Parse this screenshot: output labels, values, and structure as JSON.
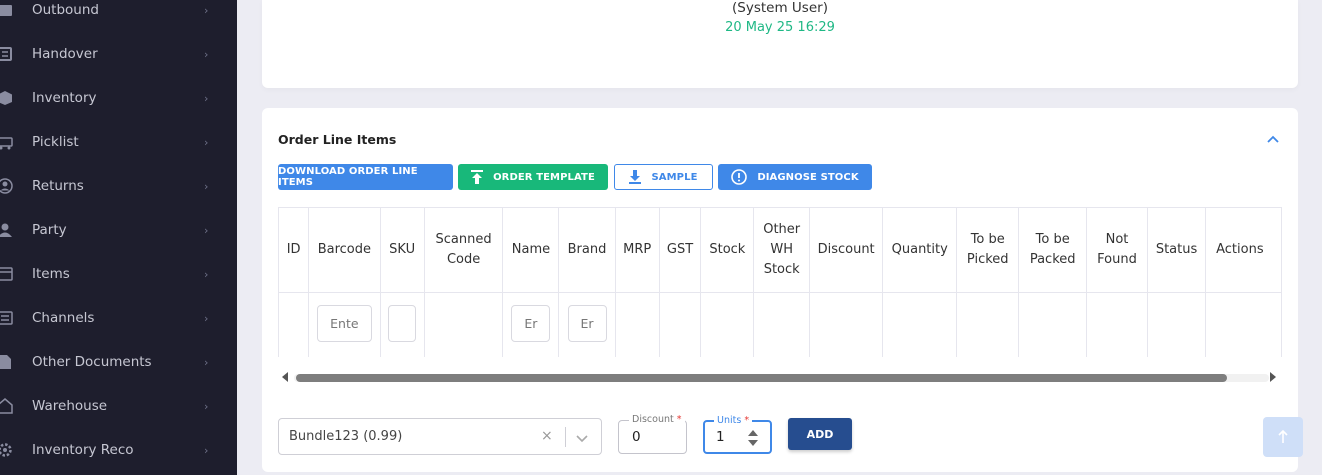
{
  "sidebar": {
    "items": [
      {
        "label": "Outbound",
        "icon": "outbound-icon"
      },
      {
        "label": "Handover",
        "icon": "handover-icon"
      },
      {
        "label": "Inventory",
        "icon": "inventory-box-icon"
      },
      {
        "label": "Picklist",
        "icon": "picklist-icon"
      },
      {
        "label": "Returns",
        "icon": "returns-icon"
      },
      {
        "label": "Party",
        "icon": "party-icon"
      },
      {
        "label": "Items",
        "icon": "items-icon"
      },
      {
        "label": "Channels",
        "icon": "channels-icon"
      },
      {
        "label": "Other Documents",
        "icon": "document-icon"
      },
      {
        "label": "Warehouse",
        "icon": "warehouse-icon"
      },
      {
        "label": "Inventory Reco",
        "icon": "gear-icon"
      }
    ],
    "chevron": "›"
  },
  "top_card": {
    "user": "(System User)",
    "date": "20 May 25 16:29"
  },
  "order_lines": {
    "title": "Order Line Items",
    "buttons": {
      "download": "DOWNLOAD ORDER LINE ITEMS",
      "template": "ORDER TEMPLATE",
      "sample": "SAMPLE",
      "diagnose": "DIAGNOSE STOCK"
    },
    "columns": [
      "ID",
      "Barcode",
      "SKU",
      "Scanned Code",
      "Name",
      "Brand",
      "MRP",
      "GST",
      "Stock",
      "Other WH Stock",
      "Discount",
      "Quantity",
      "To be Picked",
      "To be Packed",
      "Not Found",
      "Status",
      "Actions"
    ],
    "row_placeholders": {
      "barcode": "Ente",
      "sku": "",
      "name": "Er",
      "brand": "Er"
    }
  },
  "form": {
    "bundle_value": "Bundle123 (0.99)",
    "clear_glyph": "×",
    "discount_label": "Discount",
    "discount_value": "0",
    "units_label": "Units",
    "units_value": "1",
    "required_mark": "*",
    "add_label": "ADD"
  },
  "colors": {
    "sidebar_bg": "#1e1e2d",
    "primary": "#3f88e8",
    "success": "#18b87a",
    "add_button": "#264d8f"
  }
}
